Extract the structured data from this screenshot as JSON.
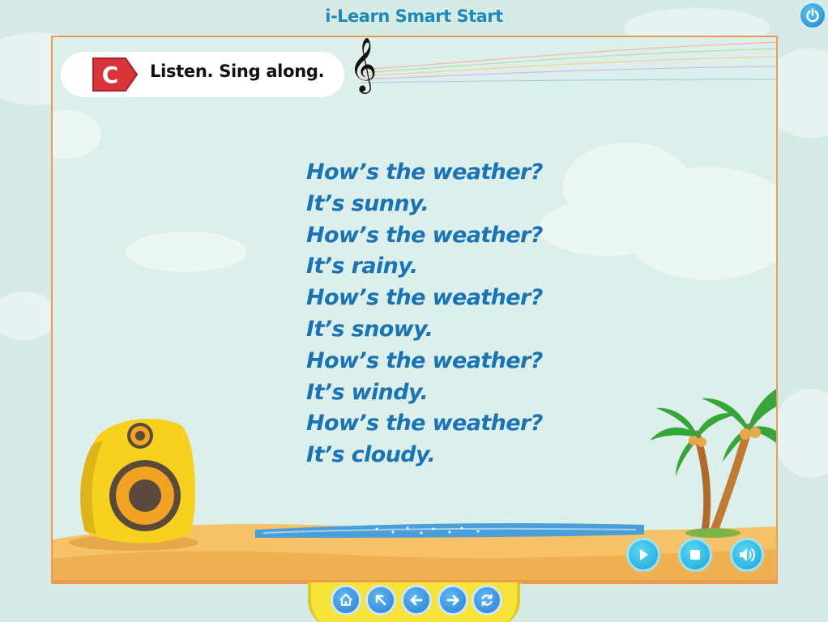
{
  "app": {
    "title": "i-Learn Smart Start"
  },
  "activity": {
    "badge_letter": "C",
    "instruction": "Listen. Sing along.",
    "clef_symbol": "𝄞"
  },
  "lyrics": [
    "How’s the weather?",
    "It’s sunny.",
    "How’s the weather?",
    "It’s rainy.",
    "How’s the weather?",
    "It’s snowy.",
    "How’s the weather?",
    "It’s windy.",
    "How’s the weather?",
    "It’s cloudy."
  ],
  "player_controls": [
    {
      "name": "play-button",
      "icon": "play-icon"
    },
    {
      "name": "stop-button",
      "icon": "stop-icon"
    },
    {
      "name": "volume-button",
      "icon": "speaker-icon"
    }
  ],
  "navigation": [
    {
      "name": "home-button",
      "icon": "home-icon"
    },
    {
      "name": "menu-button",
      "icon": "arrow-up-left-icon"
    },
    {
      "name": "previous-button",
      "icon": "arrow-left-icon"
    },
    {
      "name": "next-button",
      "icon": "arrow-right-icon"
    },
    {
      "name": "replay-button",
      "icon": "refresh-icon"
    }
  ],
  "colors": {
    "title": "#1e8ab8",
    "lyrics": "#1a74b4",
    "frame_border": "#ef9a52",
    "badge": "#d8353b",
    "tray": "#f6e43a"
  }
}
